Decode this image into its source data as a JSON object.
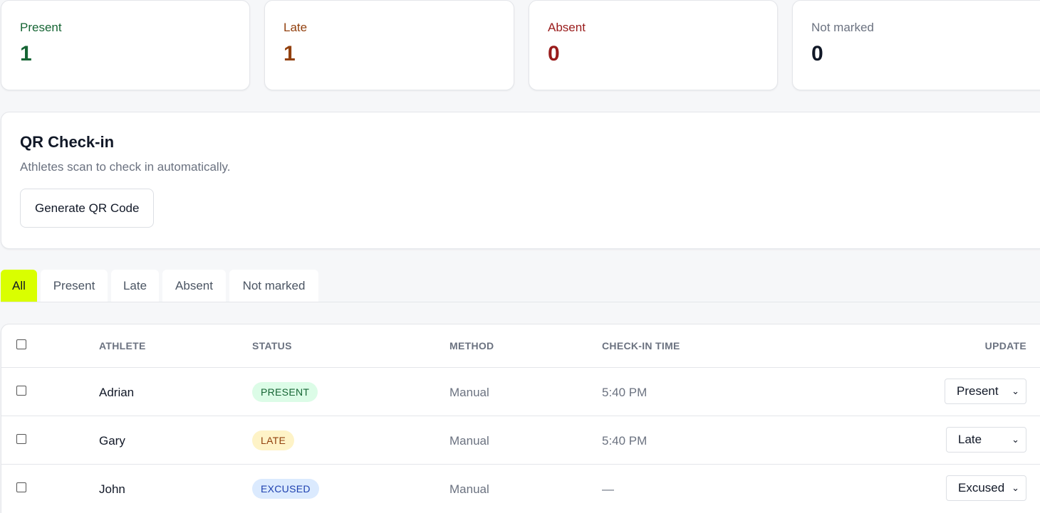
{
  "stats": [
    {
      "label": "Present",
      "value": "1",
      "color": "#166534",
      "value_color": "#166534"
    },
    {
      "label": "Late",
      "value": "1",
      "color": "#92400e",
      "value_color": "#92400e"
    },
    {
      "label": "Absent",
      "value": "0",
      "color": "#991b1b",
      "value_color": "#991b1b"
    },
    {
      "label": "Not marked",
      "value": "0",
      "color": "#6b7280",
      "value_color": "#111827"
    }
  ],
  "qr": {
    "title": "QR Check-in",
    "subtitle": "Athletes scan to check in automatically.",
    "button_label": "Generate QR Code"
  },
  "tabs": [
    {
      "label": "All",
      "active": true
    },
    {
      "label": "Present",
      "active": false
    },
    {
      "label": "Late",
      "active": false
    },
    {
      "label": "Absent",
      "active": false
    },
    {
      "label": "Not marked",
      "active": false
    }
  ],
  "table": {
    "headers": {
      "athlete": "ATHLETE",
      "status": "STATUS",
      "method": "METHOD",
      "checkin": "CHECK-IN TIME",
      "update": "UPDATE"
    },
    "rows": [
      {
        "athlete": "Adrian",
        "status": "PRESENT",
        "method": "Manual",
        "checkin": "5:40 PM",
        "update": "Present",
        "badge_bg": "#dcfce7",
        "badge_fg": "#166534"
      },
      {
        "athlete": "Gary",
        "status": "LATE",
        "method": "Manual",
        "checkin": "5:40 PM",
        "update": "Late",
        "badge_bg": "#fef3c7",
        "badge_fg": "#92400e"
      },
      {
        "athlete": "John",
        "status": "EXCUSED",
        "method": "Manual",
        "checkin": "—",
        "update": "Excused",
        "badge_bg": "#dbeafe",
        "badge_fg": "#1e40af"
      }
    ]
  },
  "colors": {
    "accent": "#d9ff00"
  }
}
